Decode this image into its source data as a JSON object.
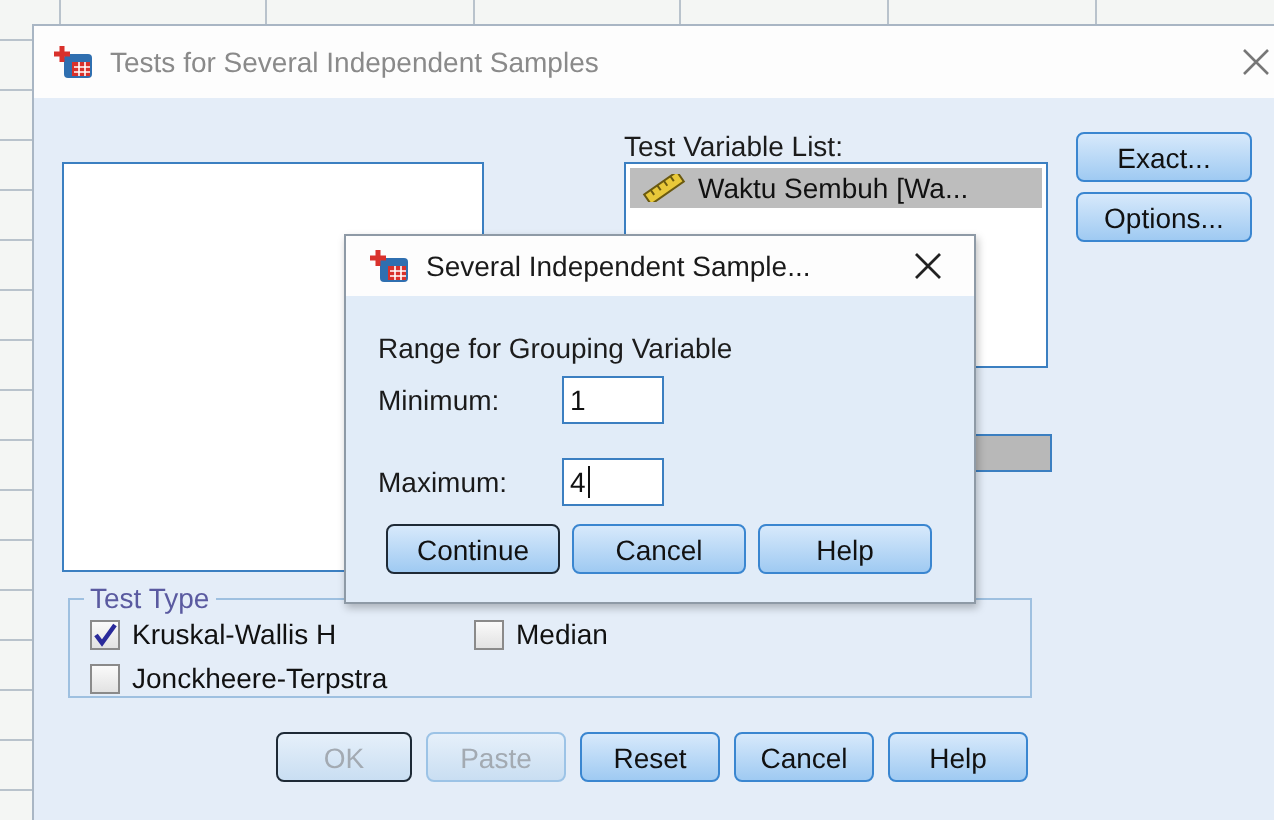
{
  "window": {
    "title": "Tests for Several Independent Samples"
  },
  "test_variable_list": {
    "label": "Test Variable List:",
    "items": [
      {
        "text": "Waktu Sembuh [Wa...",
        "selected": true
      }
    ]
  },
  "side_buttons": [
    {
      "label": "Exact..."
    },
    {
      "label": "Options..."
    }
  ],
  "test_type": {
    "title": "Test Type",
    "options": [
      {
        "label": "Kruskal-Wallis H",
        "checked": true
      },
      {
        "label": "Median",
        "checked": false
      },
      {
        "label": "Jonckheere-Terpstra",
        "checked": false
      }
    ]
  },
  "buttons": [
    {
      "label": "OK",
      "disabled": true,
      "default": true
    },
    {
      "label": "Paste",
      "disabled": true,
      "default": false
    },
    {
      "label": "Reset",
      "disabled": false,
      "default": false
    },
    {
      "label": "Cancel",
      "disabled": false,
      "default": false
    },
    {
      "label": "Help",
      "disabled": false,
      "default": false
    }
  ],
  "subdialog": {
    "title": "Several Independent Sample...",
    "heading": "Range for Grouping Variable",
    "fields": [
      {
        "label": "Minimum:",
        "value": "1",
        "focused": false
      },
      {
        "label": "Maximum:",
        "value": "4",
        "focused": true
      }
    ],
    "buttons": [
      {
        "label": "Continue",
        "default": true
      },
      {
        "label": "Cancel",
        "default": false
      },
      {
        "label": "Help",
        "default": false
      }
    ]
  }
}
